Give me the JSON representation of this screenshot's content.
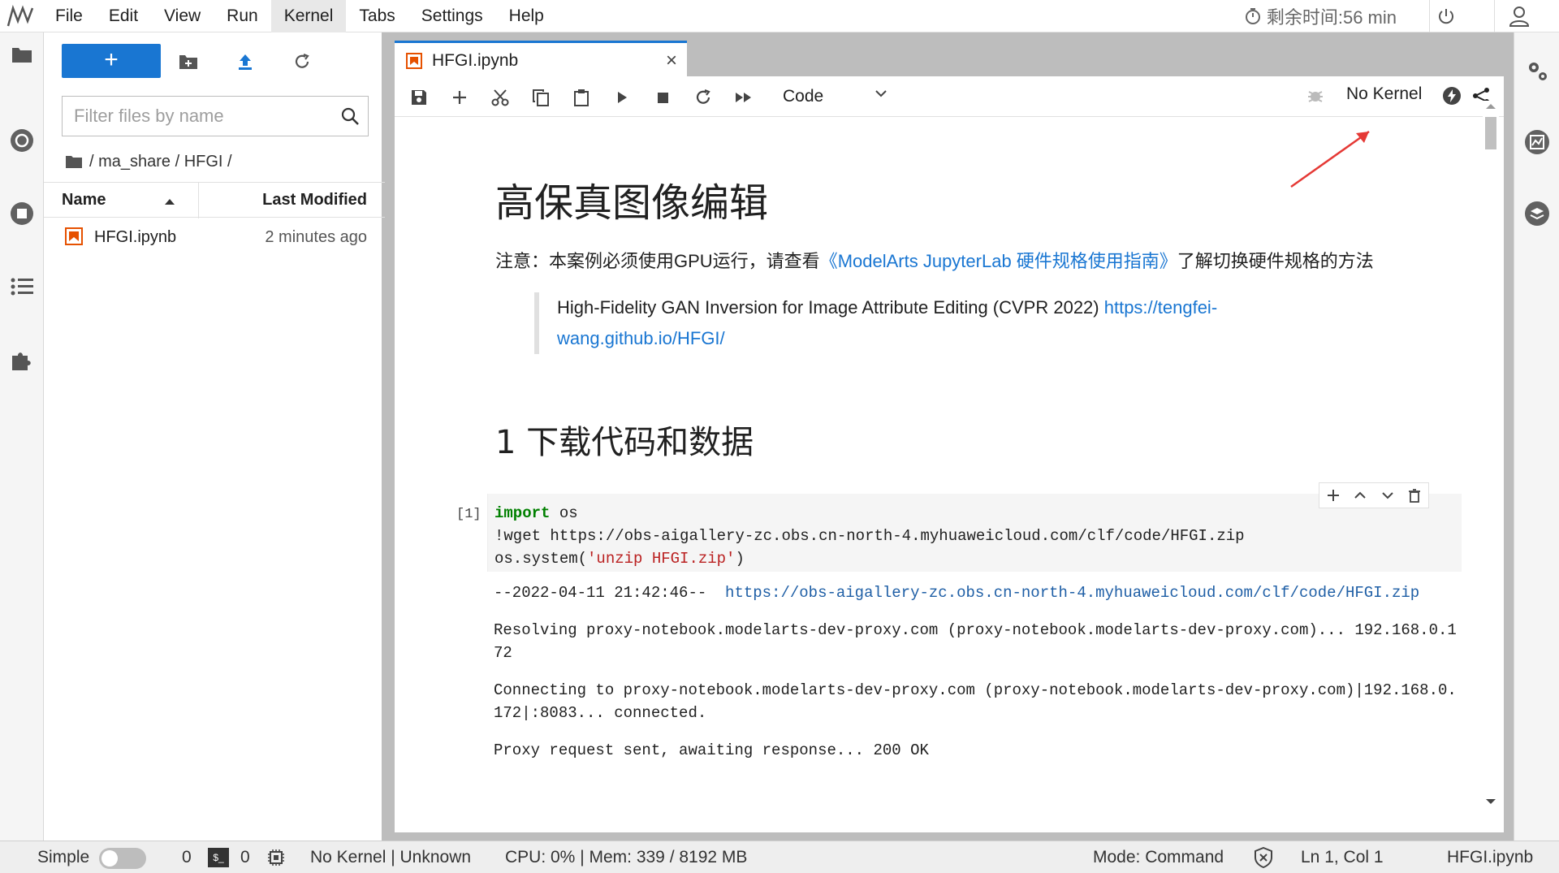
{
  "menubar": {
    "items": [
      "File",
      "Edit",
      "View",
      "Run",
      "Kernel",
      "Tabs",
      "Settings",
      "Help"
    ],
    "active_item": "Kernel",
    "timer_text": "剩余时间:56 min"
  },
  "filebrowser": {
    "new_label": "+",
    "filter_placeholder": "Filter files by name",
    "breadcrumb": "/ ma_share / HFGI /",
    "col_name": "Name",
    "col_modified": "Last Modified",
    "files": [
      {
        "name": "HFGI.ipynb",
        "modified": "2 minutes ago"
      }
    ]
  },
  "notebook": {
    "tab_title": "HFGI.ipynb",
    "tab_close": "×",
    "cell_type": "Code",
    "kernel_name": "No Kernel",
    "heading1": "高保真图像编辑",
    "notice_prefix": "注意：本案例必须使用GPU运行，请查看",
    "notice_link": "《ModelArts JupyterLab 硬件规格使用指南》",
    "notice_suffix": "了解切换硬件规格的方法",
    "quote_text": "High-Fidelity GAN Inversion for Image Attribute Editing (CVPR 2022) ",
    "quote_link_1": "https://tengfei-",
    "quote_link_2": "wang.github.io/HFGI/",
    "heading2": "1 下载代码和数据",
    "cell_prompt": "[1]",
    "code": {
      "line1_kw": "import",
      "line1_rest": " os",
      "line2": "!wget https://obs-aigallery-zc.obs.cn-north-4.myhuaweicloud.com/clf/code/HFGI.zip",
      "line3_fn": "os.system",
      "line3_open": "(",
      "line3_str": "'unzip HFGI.zip'",
      "line3_close": ")"
    },
    "output": {
      "line1_prefix": "--2022-04-11 21:42:46--  ",
      "line1_link": "https://obs-aigallery-zc.obs.cn-north-4.myhuaweicloud.com/clf/code/HFGI.zip",
      "line2": "Resolving proxy-notebook.modelarts-dev-proxy.com (proxy-notebook.modelarts-dev-proxy.com)... 192.168.0.172",
      "line3": "Connecting to proxy-notebook.modelarts-dev-proxy.com (proxy-notebook.modelarts-dev-proxy.com)|192.168.0.172|:8083... connected.",
      "line4": "Proxy request sent, awaiting response... 200 OK"
    }
  },
  "statusbar": {
    "mode_simple": "Simple",
    "count1": "0",
    "count2": "0",
    "kernel": "No Kernel | Unknown",
    "resources": "CPU: 0% | Mem: 339 / 8192 MB",
    "mode": "Mode: Command",
    "position": "Ln 1, Col 1",
    "filename": "HFGI.ipynb"
  },
  "colors": {
    "accent": "#1976d2",
    "notebook_icon": "#e65100",
    "link": "#1976d2"
  }
}
